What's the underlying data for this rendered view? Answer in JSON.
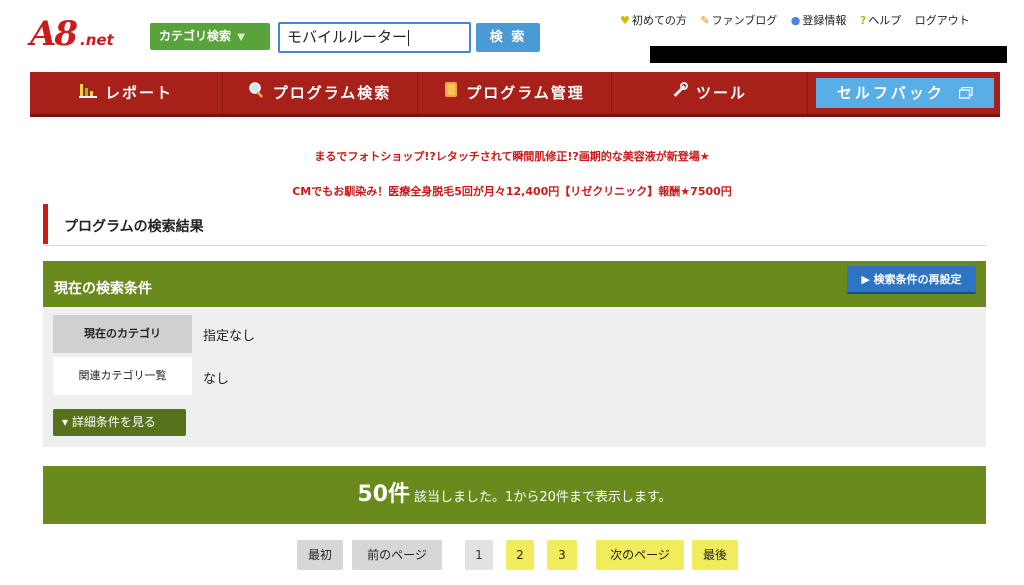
{
  "header": {
    "logo_main": "A8",
    "logo_sub": ".net",
    "category_button": "カテゴリ検索",
    "category_arrow": "▼",
    "search": {
      "value": "モバイルルーター"
    },
    "search_button": "検 索",
    "links": [
      {
        "icon": "beginner-icon",
        "label": "初めての方"
      },
      {
        "icon": "pencil-icon",
        "label": "ファンブログ"
      },
      {
        "icon": "user-icon",
        "label": "登録情報"
      },
      {
        "icon": "help-icon",
        "label": "ヘルプ"
      },
      {
        "icon": "",
        "label": "ログアウト"
      }
    ]
  },
  "nav": {
    "items": [
      {
        "icon": "chart-icon",
        "label": "レポート"
      },
      {
        "icon": "magnifier-icon",
        "label": "プログラム検索"
      },
      {
        "icon": "folder-icon",
        "label": "プログラム管理"
      },
      {
        "icon": "wrench-icon",
        "label": "ツール"
      }
    ],
    "self_back": "セルフバック",
    "self_back_icon": "new-window-icon"
  },
  "promos": [
    "まるでフォトショップ!?レタッチされて瞬間肌修正!?画期的な美容液が新登場★",
    "CMでもお馴染み！医療全身脱毛5回が月々12,400円【リゼクリニック】報酬★7500円"
  ],
  "page_title": "プログラムの検索結果",
  "conditions": {
    "title": "現在の検索条件",
    "reset_button": "▶ 検索条件の再設定",
    "rows": [
      {
        "label": "現在のカテゴリ",
        "value": "指定なし"
      },
      {
        "label": "関連カテゴリ一覧",
        "value": "なし"
      }
    ],
    "detail_button": "▾ 詳細条件を見る"
  },
  "result": {
    "count": "50件",
    "text": "該当しました。1から20件まで表示します。"
  },
  "pagination": {
    "first": "最初",
    "prev": "前のページ",
    "pages": [
      "1",
      "2",
      "3"
    ],
    "current_page": "1",
    "next": "次のページ",
    "last": "最後"
  },
  "colors": {
    "brand_red": "#a8201a",
    "olive_green": "#6b8a1e",
    "search_blue": "#4a9ad6",
    "page_yellow": "#f0ec5c"
  }
}
